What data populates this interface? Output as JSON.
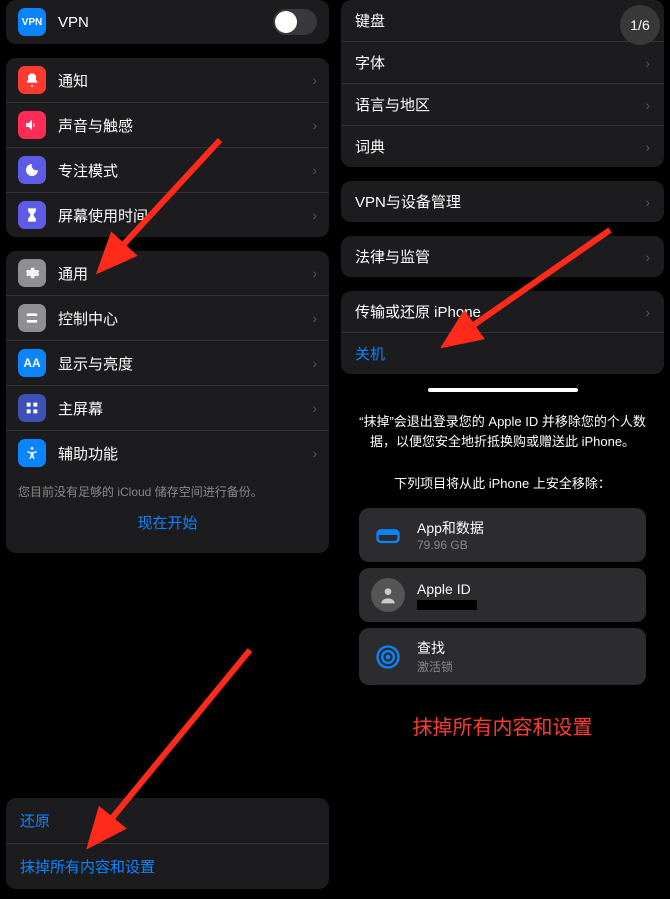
{
  "pageCounter": "1/6",
  "left": {
    "vpn": {
      "label": "VPN"
    },
    "group1": [
      {
        "label": "通知",
        "iconColor": "#ff3b30",
        "iconName": "bell-icon"
      },
      {
        "label": "声音与触感",
        "iconColor": "#ff2d55",
        "iconName": "speaker-icon"
      },
      {
        "label": "专注模式",
        "iconColor": "#5e5ce6",
        "iconName": "moon-icon"
      },
      {
        "label": "屏幕使用时间",
        "iconColor": "#5e5ce6",
        "iconName": "hourglass-icon"
      }
    ],
    "group2": [
      {
        "label": "通用",
        "iconColor": "#8e8e93",
        "iconName": "gear-icon"
      },
      {
        "label": "控制中心",
        "iconColor": "#8e8e93",
        "iconName": "switches-icon"
      },
      {
        "label": "显示与亮度",
        "iconColor": "#0a84ff",
        "iconName": "text-size-icon"
      },
      {
        "label": "主屏幕",
        "iconColor": "#3f51b5",
        "iconName": "grid-icon"
      },
      {
        "label": "辅助功能",
        "iconColor": "#0a84ff",
        "iconName": "accessibility-icon"
      }
    ],
    "icloudNote": "您目前没有足够的 iCloud 储存空间进行备份。",
    "startNow": "现在开始",
    "bottom": {
      "restore": "还原",
      "erase": "抹掉所有内容和设置"
    }
  },
  "right": {
    "group1": [
      {
        "label": "键盘"
      },
      {
        "label": "字体"
      },
      {
        "label": "语言与地区"
      },
      {
        "label": "词典"
      }
    ],
    "group2": [
      {
        "label": "VPN与设备管理"
      }
    ],
    "group3": [
      {
        "label": "法律与监管"
      }
    ],
    "group4": {
      "transfer": "传输或还原 iPhone",
      "shutdown": "关机"
    },
    "eraseInfo": "“抹掉”会退出登录您的 Apple ID 并移除您的个人数据，以便您安全地折抵换购或赠送此 iPhone。",
    "removeHeader": "下列项目将从此 iPhone 上安全移除：",
    "items": [
      {
        "title": "App和数据",
        "sub": "79.96 GB",
        "iconName": "storage-icon",
        "iconColor": "#0a84ff"
      },
      {
        "title": "Apple ID",
        "sub": "",
        "iconName": "avatar-icon",
        "iconColor": "#555"
      },
      {
        "title": "查找",
        "sub": "激活锁",
        "iconName": "findmy-icon",
        "iconColor": "#0a84ff"
      }
    ],
    "caption": "抹掉所有内容和设置"
  }
}
